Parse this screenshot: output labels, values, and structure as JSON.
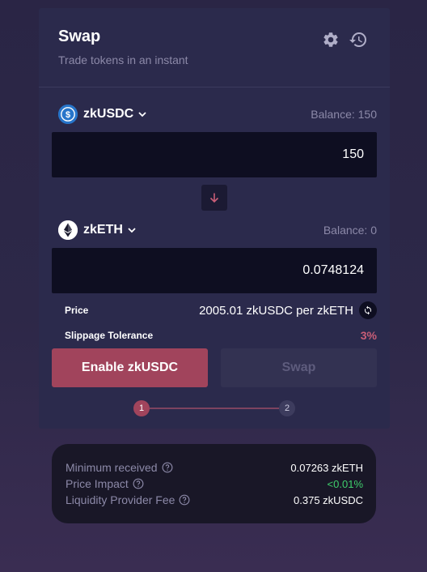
{
  "swap": {
    "title": "Swap",
    "subtitle": "Trade tokens in an instant",
    "icons": {
      "settings": "gear-icon",
      "history": "history-icon"
    }
  },
  "from": {
    "token": "zkUSDC",
    "balance": "Balance: 150",
    "amount": "150",
    "logo_color": "#2775ca"
  },
  "to": {
    "token": "zkETH",
    "balance": "Balance: 0",
    "amount": "0.0748124",
    "logo_color": "#ffffff"
  },
  "info": {
    "price_label": "Price",
    "price_value": "2005.01 zkUSDC per zkETH",
    "slippage_label": "Slippage Tolerance",
    "slippage_value": "3%"
  },
  "buttons": {
    "enable": "Enable zkUSDC",
    "swap": "Swap"
  },
  "stepper": {
    "step1": "1",
    "step2": "2",
    "current": 1
  },
  "summary": {
    "rows": [
      {
        "label": "Minimum received",
        "value": "0.07263 zkETH"
      },
      {
        "label": "Price Impact",
        "value": "<0.01%"
      },
      {
        "label": "Liquidity Provider Fee",
        "value": "0.375 zkUSDC"
      }
    ]
  },
  "colors": {
    "accent": "#a1445c",
    "positive": "#3fcf6c",
    "slippage": "#c95e77"
  }
}
